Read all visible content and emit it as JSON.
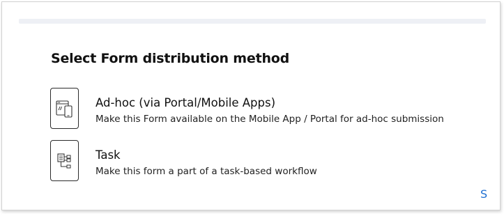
{
  "dialog": {
    "title": "Select Form distribution method",
    "options": [
      {
        "title": "Ad-hoc (via Portal/Mobile Apps)",
        "description": "Make this Form available on the Mobile App / Portal for ad-hoc submission",
        "icon": "portal-mobile-icon"
      },
      {
        "title": "Task",
        "description": "Make this form a part of a task-based workflow",
        "icon": "workflow-icon"
      }
    ],
    "corner_link": "S"
  },
  "colors": {
    "link": "#1f6fd1",
    "text": "#111111",
    "strip": "#eef0f5"
  }
}
